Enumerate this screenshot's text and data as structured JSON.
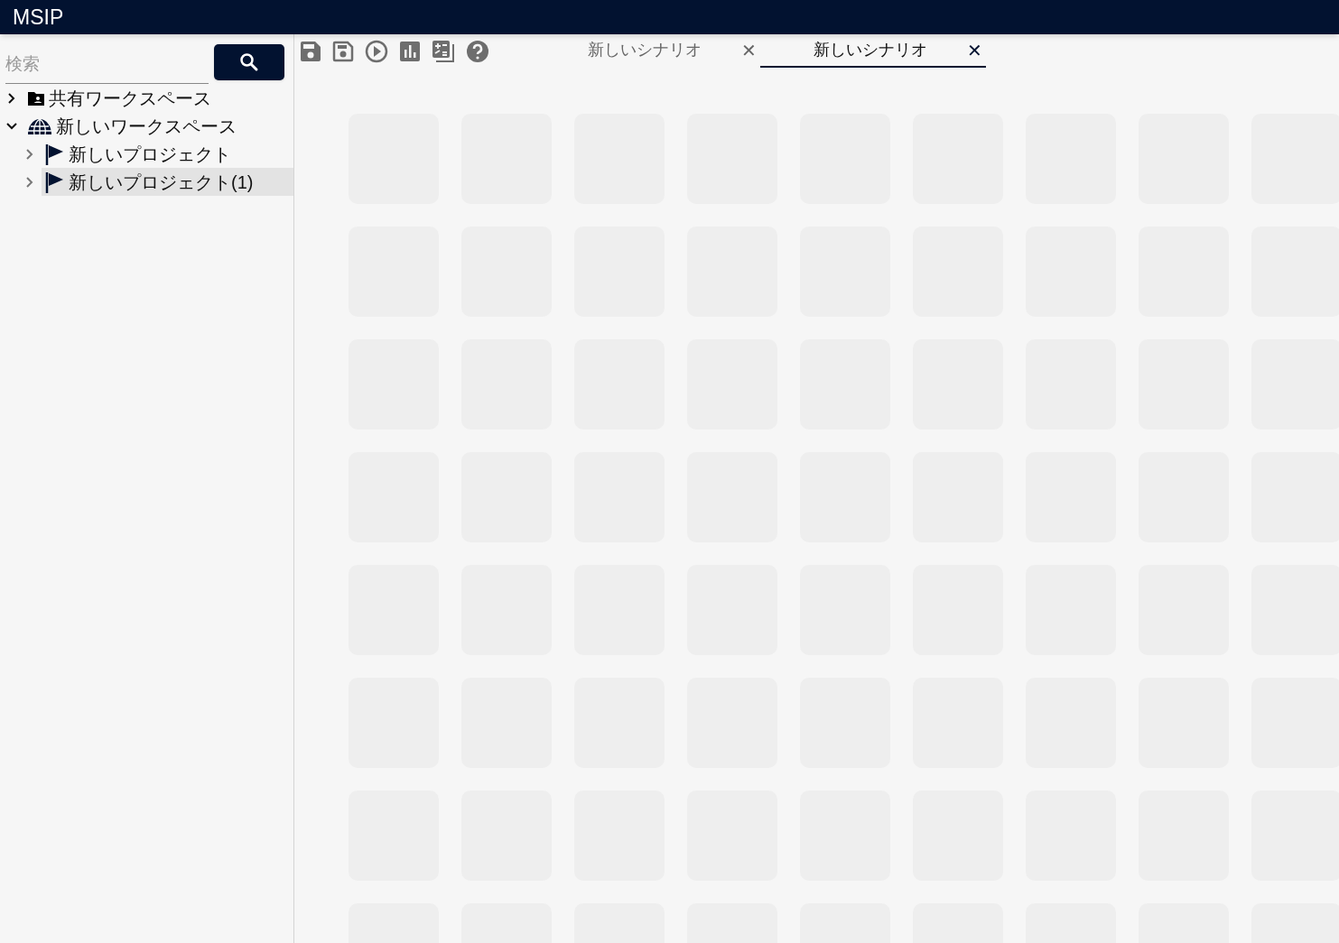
{
  "app_bar": {
    "title": "MSIP"
  },
  "search": {
    "placeholder": "検索"
  },
  "tree": [
    {
      "label": "共有ワークスペース",
      "kind": "shared-folder",
      "expanded": false,
      "selected": false
    },
    {
      "label": "新しいワークスペース",
      "kind": "globe",
      "expanded": true,
      "selected": false,
      "children": [
        {
          "label": "新しいプロジェクト",
          "kind": "flag",
          "expanded": false,
          "selected": false
        },
        {
          "label": "新しいプロジェクト(1)",
          "kind": "flag",
          "expanded": false,
          "selected": true
        }
      ]
    }
  ],
  "toolbar": [
    {
      "kind": "save"
    },
    {
      "kind": "save-as"
    },
    {
      "kind": "run"
    },
    {
      "kind": "chart"
    },
    {
      "kind": "calculator"
    },
    {
      "kind": "help"
    }
  ],
  "tabs": [
    {
      "label": "新しいシナリオ",
      "close": "✕",
      "selected": false
    },
    {
      "label": "新しいシナリオ",
      "close": "✕",
      "selected": true
    }
  ]
}
